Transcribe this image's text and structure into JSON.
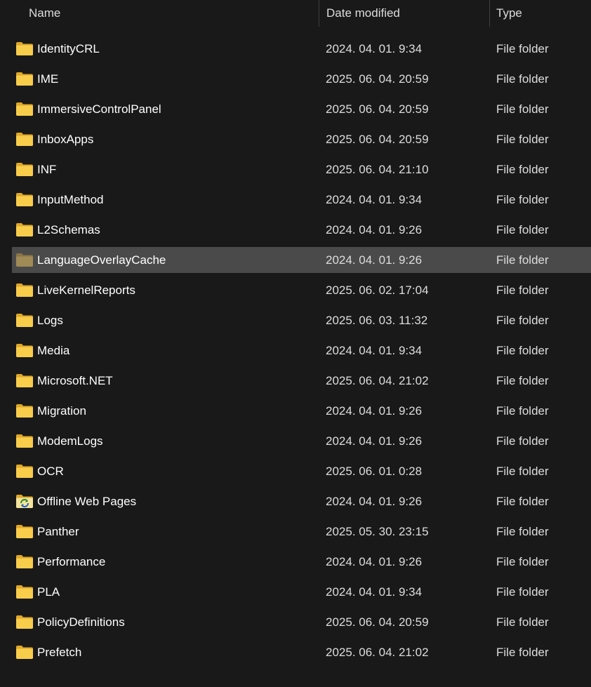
{
  "columns": {
    "name": "Name",
    "date": "Date modified",
    "type": "Type"
  },
  "colors": {
    "background": "#191919",
    "selected_row": "#4a4a4a",
    "folder_yellow": "#f8cd4b",
    "folder_dark": "#e0a82a"
  },
  "rows": [
    {
      "name": "IdentityCRL",
      "date": "2024. 04. 01. 9:34",
      "type": "File folder",
      "icon": "folder-icon"
    },
    {
      "name": "IME",
      "date": "2025. 06. 04. 20:59",
      "type": "File folder",
      "icon": "folder-icon"
    },
    {
      "name": "ImmersiveControlPanel",
      "date": "2025. 06. 04. 20:59",
      "type": "File folder",
      "icon": "folder-icon"
    },
    {
      "name": "InboxApps",
      "date": "2025. 06. 04. 20:59",
      "type": "File folder",
      "icon": "folder-icon"
    },
    {
      "name": "INF",
      "date": "2025. 06. 04. 21:10",
      "type": "File folder",
      "icon": "folder-icon"
    },
    {
      "name": "InputMethod",
      "date": "2024. 04. 01. 9:34",
      "type": "File folder",
      "icon": "folder-icon"
    },
    {
      "name": "L2Schemas",
      "date": "2024. 04. 01. 9:26",
      "type": "File folder",
      "icon": "folder-icon"
    },
    {
      "name": "LanguageOverlayCache",
      "date": "2024. 04. 01. 9:26",
      "type": "File folder",
      "icon": "folder-icon",
      "selected": true,
      "dimmed": true
    },
    {
      "name": "LiveKernelReports",
      "date": "2025. 06. 02. 17:04",
      "type": "File folder",
      "icon": "folder-icon"
    },
    {
      "name": "Logs",
      "date": "2025. 06. 03. 11:32",
      "type": "File folder",
      "icon": "folder-icon"
    },
    {
      "name": "Media",
      "date": "2024. 04. 01. 9:34",
      "type": "File folder",
      "icon": "folder-icon"
    },
    {
      "name": "Microsoft.NET",
      "date": "2025. 06. 04. 21:02",
      "type": "File folder",
      "icon": "folder-icon"
    },
    {
      "name": "Migration",
      "date": "2024. 04. 01. 9:26",
      "type": "File folder",
      "icon": "folder-icon"
    },
    {
      "name": "ModemLogs",
      "date": "2024. 04. 01. 9:26",
      "type": "File folder",
      "icon": "folder-icon"
    },
    {
      "name": "OCR",
      "date": "2025. 06. 01. 0:28",
      "type": "File folder",
      "icon": "folder-icon"
    },
    {
      "name": "Offline Web Pages",
      "date": "2024. 04. 01. 9:26",
      "type": "File folder",
      "icon": "sync-folder-icon"
    },
    {
      "name": "Panther",
      "date": "2025. 05. 30. 23:15",
      "type": "File folder",
      "icon": "folder-icon"
    },
    {
      "name": "Performance",
      "date": "2024. 04. 01. 9:26",
      "type": "File folder",
      "icon": "folder-icon"
    },
    {
      "name": "PLA",
      "date": "2024. 04. 01. 9:34",
      "type": "File folder",
      "icon": "folder-icon"
    },
    {
      "name": "PolicyDefinitions",
      "date": "2025. 06. 04. 20:59",
      "type": "File folder",
      "icon": "folder-icon"
    },
    {
      "name": "Prefetch",
      "date": "2025. 06. 04. 21:02",
      "type": "File folder",
      "icon": "folder-icon"
    }
  ]
}
